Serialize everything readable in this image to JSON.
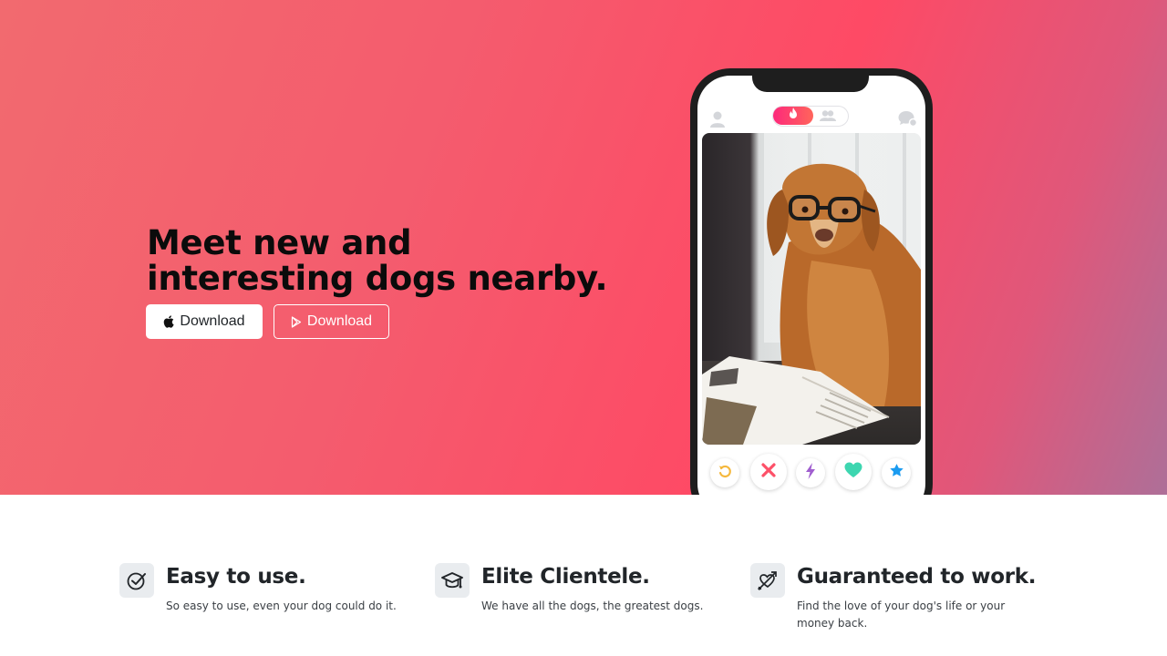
{
  "hero": {
    "title": "Meet new and interesting dogs nearby.",
    "buttons": {
      "apple_label": "Download",
      "play_label": "Download"
    },
    "colors": {
      "gradient_start": "#f26a6f",
      "gradient_mid": "#fe4a65",
      "gradient_end": "#ae6f98"
    }
  },
  "phone": {
    "top_icons": [
      "profile-icon",
      "flame-icon",
      "group-icon",
      "chat-icon"
    ],
    "photo": "dog-with-glasses",
    "actions": [
      "rewind-icon",
      "nope-icon",
      "boost-icon",
      "like-icon",
      "super-like-icon"
    ],
    "action_colors": {
      "rewind": "#f5b83d",
      "nope": "#fd5068",
      "boost": "#a05ecf",
      "like": "#3dd6b0",
      "super_like": "#1a9bf0"
    }
  },
  "features": [
    {
      "icon": "check-circle-icon",
      "title": "Easy to use.",
      "text": "So easy to use, even your dog could do it."
    },
    {
      "icon": "graduation-cap-icon",
      "title": "Elite Clientele.",
      "text": "We have all the dogs, the greatest dogs."
    },
    {
      "icon": "heart-arrow-icon",
      "title": "Guaranteed to work.",
      "text": "Find the love of your dog's life or your money back."
    }
  ]
}
